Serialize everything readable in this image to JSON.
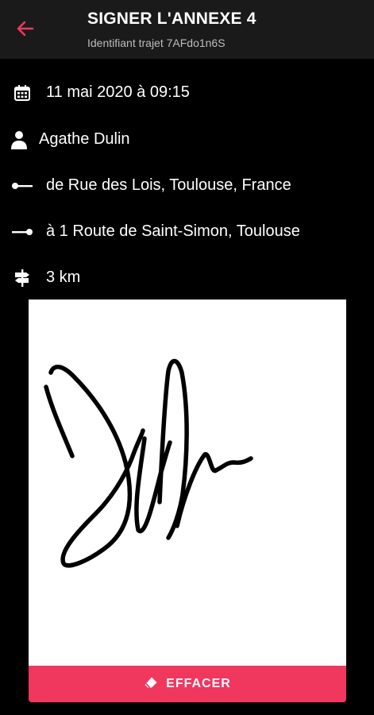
{
  "header": {
    "title": "SIGNER L'ANNEXE 4",
    "subtitle": "Identifiant trajet 7AFdo1n6S",
    "back_icon": "arrow-left-icon",
    "accent_color": "#f0375e",
    "background_color": "#1a1a1a"
  },
  "trip": {
    "date": "11 mai 2020 à 09:15",
    "person": "Agathe Dulin",
    "from": "de Rue des Lois, Toulouse, France",
    "to": "à 1 Route de Saint-Simon, Toulouse",
    "distance": "3 km",
    "icons": {
      "date": "calendar-icon",
      "person": "person-icon",
      "from": "start-point-icon",
      "to": "end-point-icon",
      "distance": "signpost-icon"
    }
  },
  "signature": {
    "has_signature": true,
    "background_color": "#ffffff",
    "ink_color": "#000000"
  },
  "actions": {
    "clear_label": "EFFACER",
    "clear_icon": "eraser-icon",
    "clear_color": "#f0375e"
  }
}
